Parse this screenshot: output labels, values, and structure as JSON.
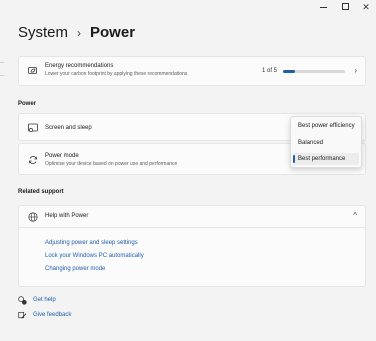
{
  "window": {
    "min_glyph": "—",
    "close_glyph": "✕"
  },
  "breadcrumb": {
    "parent": "System",
    "separator": "›",
    "current": "Power"
  },
  "energy": {
    "title": "Energy recommendations",
    "subtitle": "Lower your carbon footprint by applying these recommendations",
    "count": "1 of 5",
    "progress": 0.2,
    "chevron": "›"
  },
  "power_section": {
    "label": "Power",
    "screen_sleep": {
      "title": "Screen and sleep"
    },
    "power_mode": {
      "title": "Power mode",
      "subtitle": "Optimise your device based on power use and performance",
      "options": [
        "Best power efficiency",
        "Balanced",
        "Best performance"
      ],
      "selected": "Best performance"
    }
  },
  "related": {
    "label": "Related support",
    "help": {
      "title": "Help with Power",
      "chevron": "^",
      "links": [
        "Adjusting power and sleep settings",
        "Lock your Windows PC automatically",
        "Changing power mode"
      ]
    }
  },
  "footer": {
    "get_help": "Get help",
    "give_feedback": "Give feedback"
  },
  "colors": {
    "accent": "#1f5faa",
    "background": "#f3f3f3",
    "card": "#fbfbfb"
  }
}
